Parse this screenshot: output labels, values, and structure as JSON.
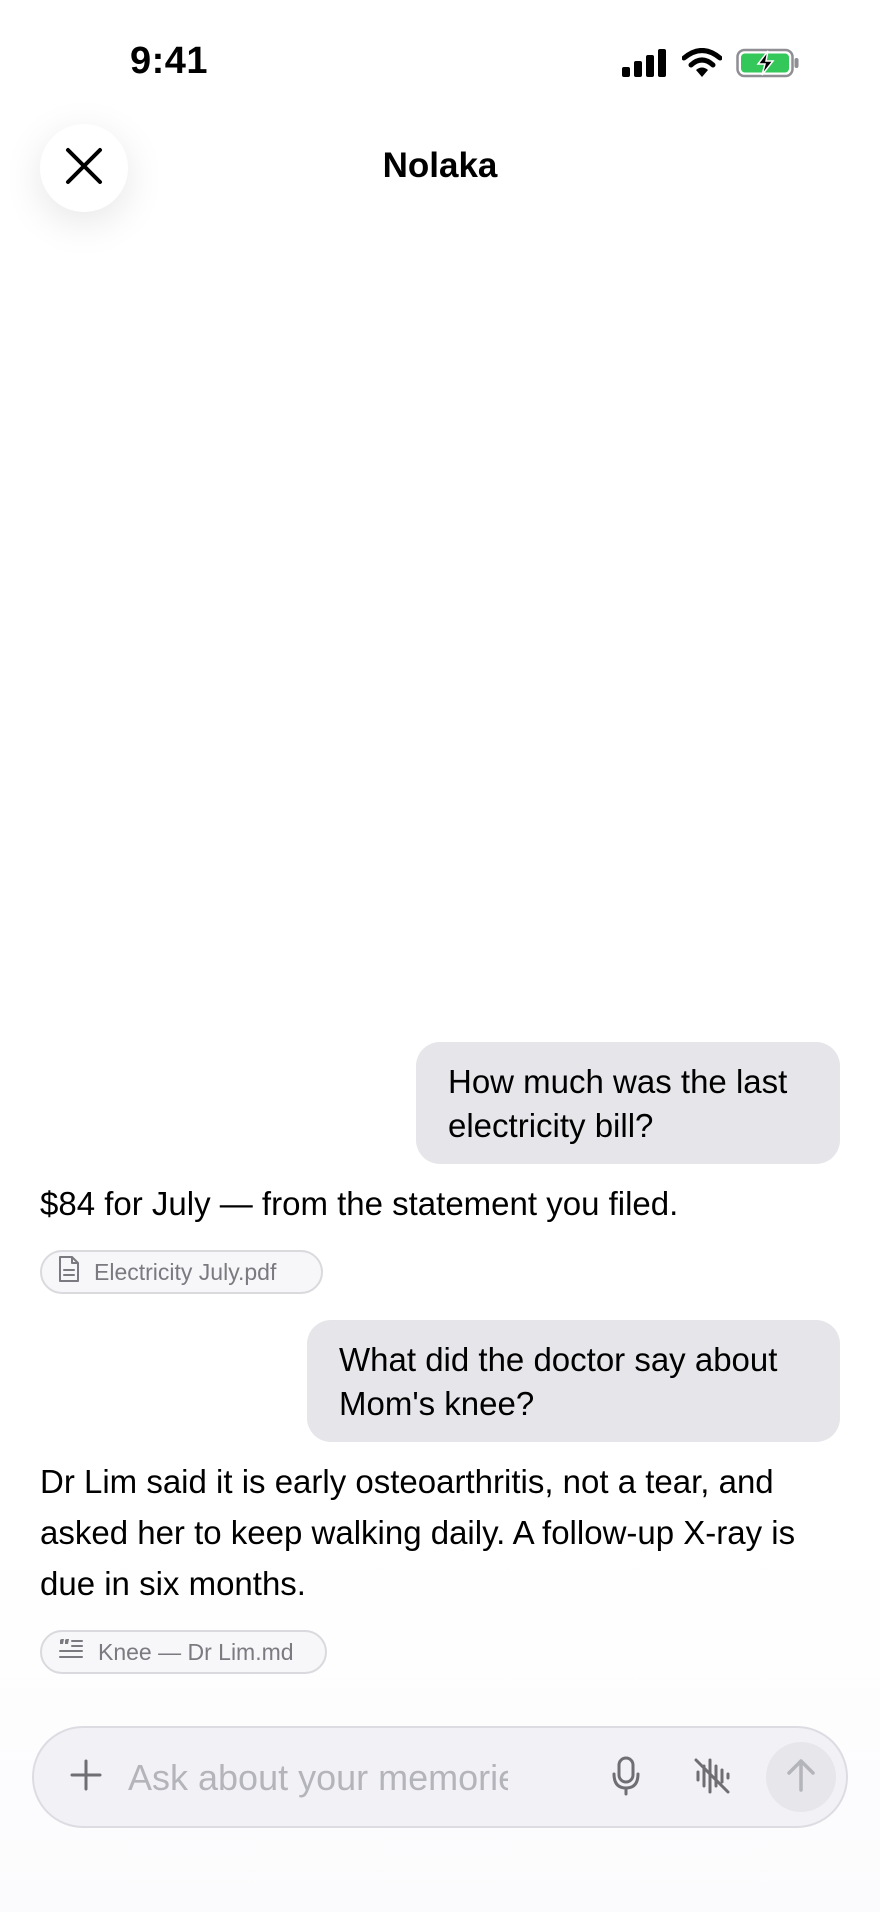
{
  "status_bar": {
    "time": "9:41",
    "icons": [
      "cellular-signal-icon",
      "wifi-icon",
      "battery-charging-icon"
    ],
    "battery_color": "#34c759"
  },
  "header": {
    "title": "Nolaka",
    "close_icon": "close-icon"
  },
  "messages": [
    {
      "role": "user",
      "text": "How much was the last electricity bill?"
    },
    {
      "role": "assistant",
      "text": "$84 for July — from the statement you filed.",
      "source": {
        "icon": "document-icon",
        "label": "Electricity July.pdf"
      }
    },
    {
      "role": "user",
      "text": "What did the doctor say about Mom's knee?"
    },
    {
      "role": "assistant",
      "text": "Dr Lim said it is early osteoarthritis, not a tear, and asked her to keep walking daily. A follow-up X-ray is due in six months.",
      "source": {
        "icon": "note-quote-icon",
        "label": "Knee — Dr Lim.md"
      }
    }
  ],
  "composer": {
    "placeholder": "Ask about your memories",
    "value": "",
    "icons": [
      "plus-icon",
      "microphone-icon",
      "voice-off-icon",
      "arrow-up-icon"
    ]
  },
  "colors": {
    "user_bubble": "#e5e5ea",
    "chip_border": "#d9d9de",
    "placeholder": "#b4b4bb"
  }
}
